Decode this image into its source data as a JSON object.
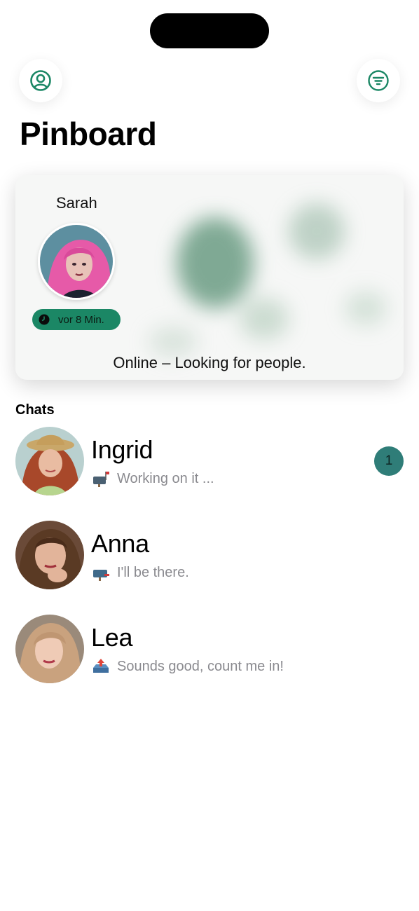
{
  "header": {
    "title": "Pinboard",
    "profile_icon": "person-circle-icon",
    "filter_icon": "filter-lines-icon"
  },
  "pin_card": {
    "name": "Sarah",
    "time_ago": "vor 8 Min.",
    "time_icon": "clock-icon",
    "status": "Online – Looking for people."
  },
  "chats": {
    "section_title": "Chats",
    "items": [
      {
        "name": "Ingrid",
        "preview": "Working on it ...",
        "status_icon": "mailbox-flag-up-icon",
        "unread": "1"
      },
      {
        "name": "Anna",
        "preview": "I'll be there.",
        "status_icon": "mailbox-flag-down-icon"
      },
      {
        "name": "Lea",
        "preview": "Sounds good, count me in!",
        "status_icon": "outbox-tray-icon"
      }
    ]
  },
  "colors": {
    "accent": "#1b8765",
    "badge": "#2f7d78",
    "secondary_text": "#8a8a8f"
  }
}
